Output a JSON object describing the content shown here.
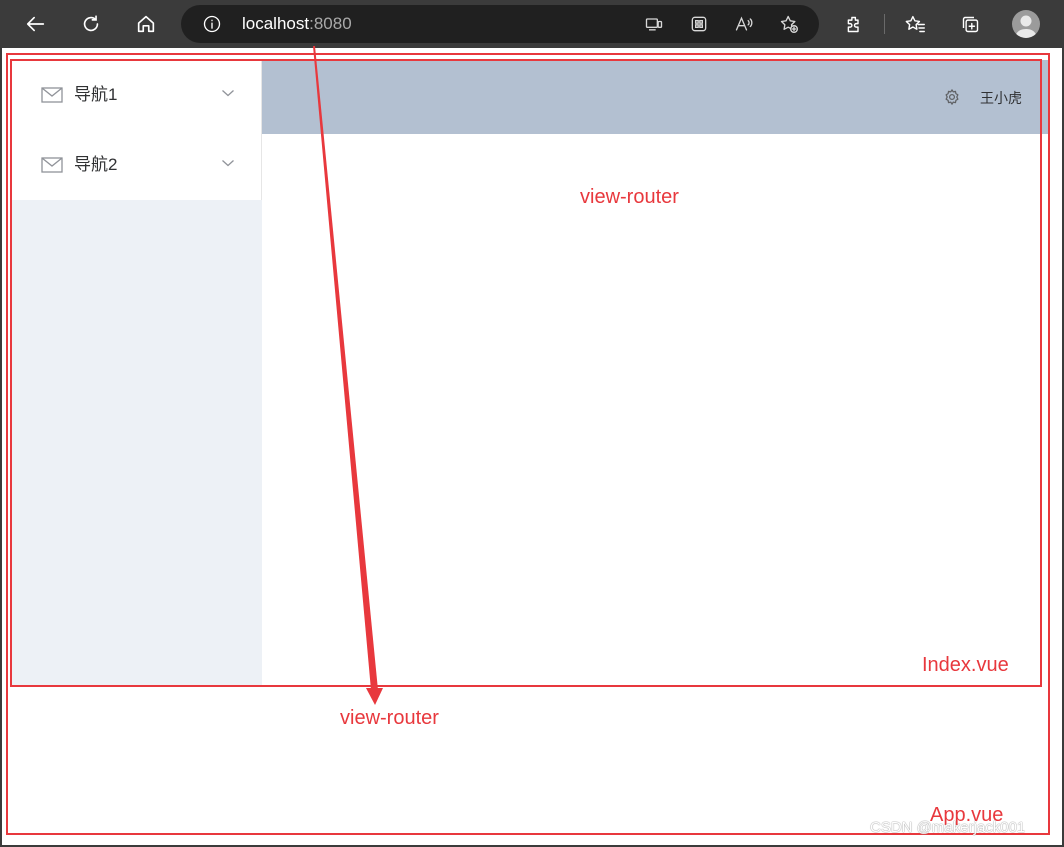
{
  "browser": {
    "url_host": "localhost",
    "url_port": ":8080"
  },
  "sidebar": {
    "items": [
      {
        "label": "导航1",
        "icon": "mail-icon"
      },
      {
        "label": "导航2",
        "icon": "mail-icon"
      }
    ]
  },
  "header": {
    "username": "王小虎",
    "icon": "gear-icon"
  },
  "annotations": {
    "inner_router": "view-router",
    "outer_router": "view-router",
    "index_file": "Index.vue",
    "app_file": "App.vue",
    "color": "#e8383d"
  },
  "watermark": "CSDN @makerjack001",
  "colors": {
    "header_bg": "#b3c0d1",
    "sidebar_bg": "#edf1f6",
    "chrome_bg": "#3b3b3b"
  }
}
